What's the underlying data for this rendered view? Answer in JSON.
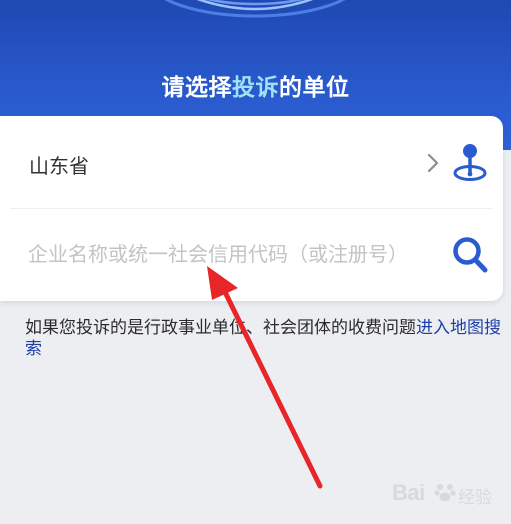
{
  "header": {
    "title_part1": "请选择",
    "title_highlight": "投诉",
    "title_part2": "的单位",
    "highlight_color": "#9fe1f7",
    "background_color": "#2a5cd0"
  },
  "region_row": {
    "value": "山东省",
    "chevron_icon": "chevron-right-icon",
    "location_icon": "map-pin-icon"
  },
  "search_row": {
    "placeholder": "企业名称或统一社会信用代码（或注册号）",
    "search_icon": "search-icon",
    "icon_color": "#2a5cd0"
  },
  "note": {
    "text": "如果您投诉的是行政事业单位、社会团体的收费问题",
    "link": "进入地图搜索",
    "link_color": "#1e3fa8"
  },
  "annotation": {
    "arrow_color": "#e8262a"
  },
  "watermark": {
    "brand": "Bai",
    "brand_suffix": "经验"
  }
}
